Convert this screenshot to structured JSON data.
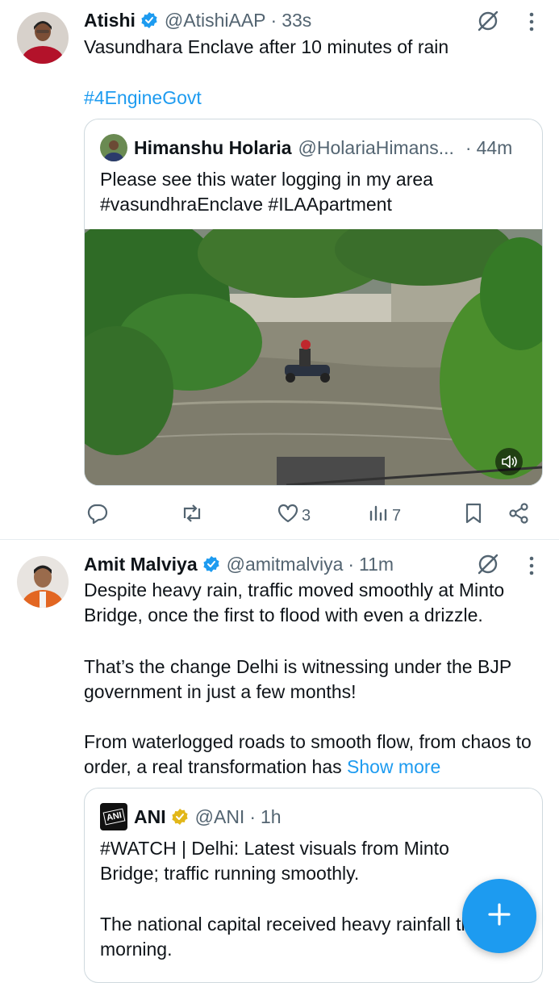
{
  "tweets": [
    {
      "name": "Atishi",
      "handle": "@AtishiAAP",
      "time": "33s",
      "text": "Vasundhara Enclave after 10 minutes of rain",
      "hashtag": "#4EngineGovt",
      "quote": {
        "name": "Himanshu Holaria",
        "handle": "@HolariaHimans...",
        "time": "44m",
        "text_line1": "Please see this water logging in my area",
        "text_line2": "#vasundhraEnclave #ILAApartment"
      },
      "likes": "3",
      "views": "7"
    },
    {
      "name": "Amit Malviya",
      "handle": "@amitmalviya",
      "time": "11m",
      "para1": "Despite heavy rain, traffic moved smoothly at Minto Bridge, once the first to flood with even a drizzle.",
      "para2": "That’s the change Delhi is witnessing under the BJP government in just a few months!",
      "para3": "From waterlogged roads to smooth flow, from chaos to order, a real transformation has",
      "show_more": "Show more",
      "quote": {
        "name": "ANI",
        "handle": "@ANI",
        "time": "1h",
        "avatar_text": "ANI",
        "para1": "#WATCH | Delhi: Latest visuals from Minto Bridge; traffic running smoothly.",
        "para2": "The national capital received heavy rainfall this morning."
      }
    }
  ],
  "separator": "·",
  "colors": {
    "accent": "#1d9bf0",
    "gold": "#e2b719",
    "muted": "#536471"
  }
}
